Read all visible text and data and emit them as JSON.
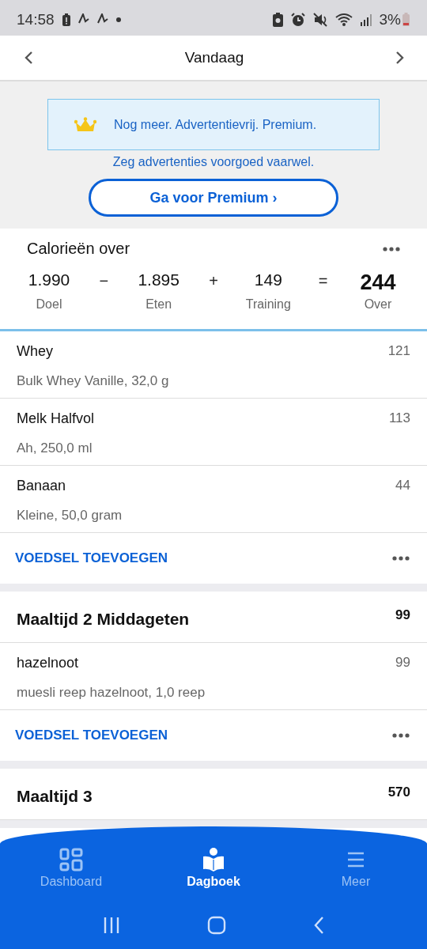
{
  "status_bar": {
    "time": "14:58",
    "battery": "3%"
  },
  "header": {
    "title": "Vandaag"
  },
  "promo": {
    "banner": "Nog meer. Advertentievrij. Premium.",
    "tagline": "Zeg advertenties voorgoed vaarwel.",
    "button": "Ga voor Premium ›"
  },
  "summary": {
    "title": "Calorieën over",
    "terms": [
      {
        "value": "1.990",
        "label": "Doel",
        "operator": "−"
      },
      {
        "value": "1.895",
        "label": "Eten",
        "operator": "+"
      },
      {
        "value": "149",
        "label": "Training",
        "operator": "="
      },
      {
        "value": "244",
        "label": "Over"
      }
    ]
  },
  "meals": [
    {
      "items": [
        {
          "name": "Whey",
          "detail": "Bulk Whey Vanille, 32,0 g",
          "calories": "121"
        },
        {
          "name": "Melk Halfvol",
          "detail": "Ah, 250,0 ml",
          "calories": "113"
        },
        {
          "name": "Banaan",
          "detail": "Kleine, 50,0 gram",
          "calories": "44"
        }
      ],
      "add_label": "VOEDSEL TOEVOEGEN"
    },
    {
      "title": "Maaltijd 2 Middageten",
      "total": "99",
      "items": [
        {
          "name": "hazelnoot",
          "detail": "muesli reep hazelnoot, 1,0 reep",
          "calories": "99"
        }
      ],
      "add_label": "VOEDSEL TOEVOEGEN"
    },
    {
      "title": "Maaltijd 3",
      "total": "570"
    }
  ],
  "bottom_nav": [
    {
      "label": "Dashboard",
      "kind": "dashboard",
      "selected": false
    },
    {
      "label": "Dagboek",
      "kind": "diary",
      "selected": true
    },
    {
      "label": "Meer",
      "kind": "more",
      "selected": false
    }
  ]
}
